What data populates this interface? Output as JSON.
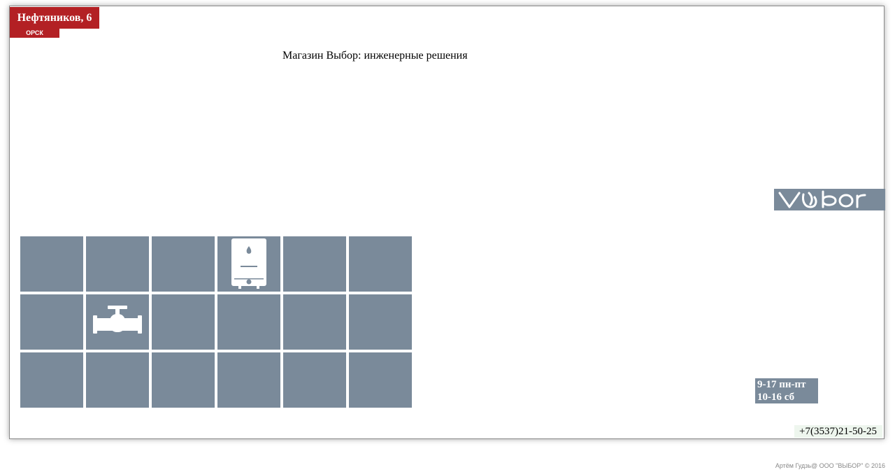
{
  "header": {
    "address": "Нефтяников, 6",
    "city": "ОРСК"
  },
  "main": {
    "title": "Магазин Выбор: инженерные решения"
  },
  "logo": {
    "text": "vybor",
    "icon": "vybor-logo-icon"
  },
  "tiles": [
    {
      "icon": ""
    },
    {
      "icon": ""
    },
    {
      "icon": ""
    },
    {
      "icon": "water-heater-icon"
    },
    {
      "icon": ""
    },
    {
      "icon": ""
    },
    {
      "icon": ""
    },
    {
      "icon": "pipe-valve-icon"
    },
    {
      "icon": ""
    },
    {
      "icon": ""
    },
    {
      "icon": ""
    },
    {
      "icon": ""
    },
    {
      "icon": ""
    },
    {
      "icon": ""
    },
    {
      "icon": ""
    },
    {
      "icon": ""
    },
    {
      "icon": ""
    },
    {
      "icon": ""
    }
  ],
  "hours": {
    "weekdays": "9-17 пн-пт",
    "saturday": "10-16 сб"
  },
  "contact": {
    "phone": "+7(3537)21-50-25"
  },
  "footer": {
    "copyright": "Артём Гудзь@ ООО \"ВЫБОР\" © 2016"
  },
  "colors": {
    "brand_red": "#b32024",
    "tile_gray": "#7a8a9a",
    "phone_bg": "#eef6ee"
  }
}
